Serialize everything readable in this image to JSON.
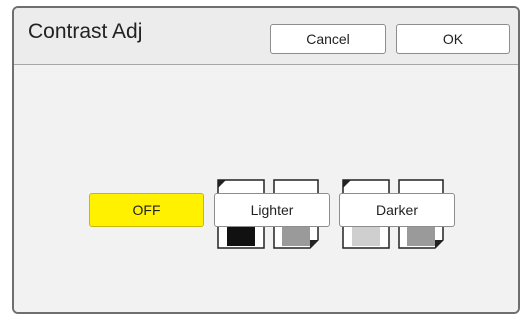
{
  "dialog": {
    "title": "Contrast Adj",
    "cancel_label": "Cancel",
    "ok_label": "OK"
  },
  "options": [
    {
      "label": "OFF",
      "selected": true,
      "icon": "contrast-off-icon"
    },
    {
      "label": "Lighter",
      "selected": false,
      "icon": "contrast-lighter-icon"
    },
    {
      "label": "Darker",
      "selected": false,
      "icon": "contrast-darker-icon"
    }
  ],
  "colors": {
    "selected": "#fff100",
    "frame": "#6f6f6f",
    "background": "#ececec",
    "dark_figure": "#111111",
    "mid_figure": "#9a9a9a",
    "light_figure": "#cfcfcf"
  }
}
